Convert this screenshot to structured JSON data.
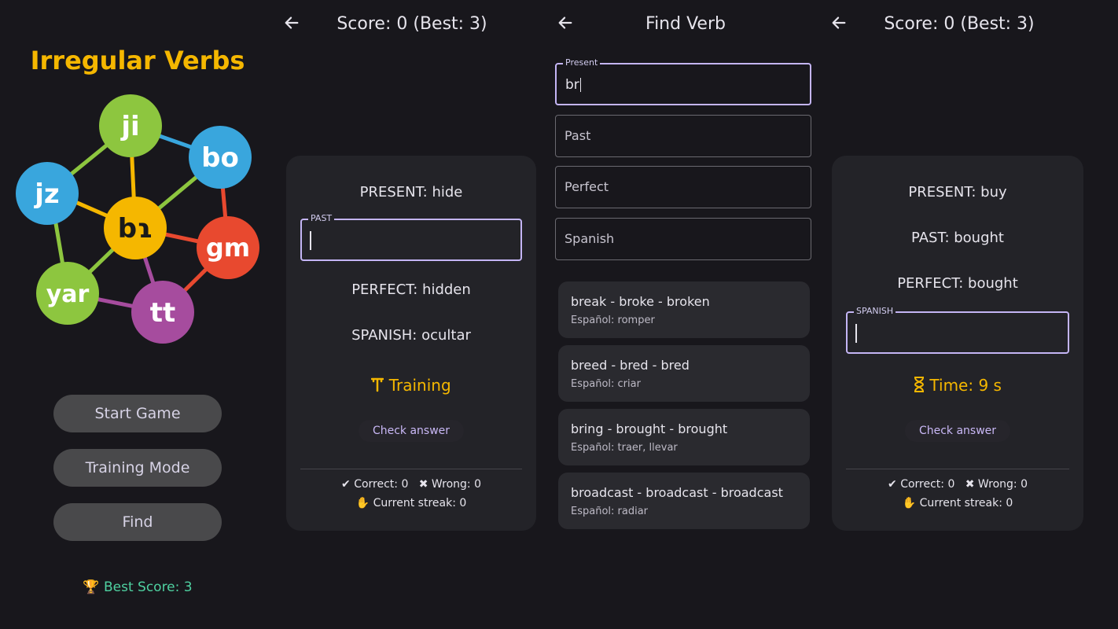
{
  "menu": {
    "title": "Irregular Verbs",
    "graph_nodes": [
      {
        "label": "ji",
        "color": "#8dc63f"
      },
      {
        "label": "bo",
        "color": "#39a6dd"
      },
      {
        "label": "jz",
        "color": "#39a6dd"
      },
      {
        "label": "bɿ",
        "color": "#f5b700"
      },
      {
        "label": "gm",
        "color": "#e8492f"
      },
      {
        "label": "yar",
        "color": "#8dc63f"
      },
      {
        "label": "tt",
        "color": "#a64c9e"
      }
    ],
    "buttons": {
      "start": "Start Game",
      "training": "Training Mode",
      "find": "Find"
    },
    "best_score": "🏆 Best Score: 3"
  },
  "training": {
    "header_title": "Score: 0  (Best: 3)",
    "present": "PRESENT: hide",
    "past_label": "PAST",
    "past_value": "",
    "perfect": "PERFECT: hidden",
    "spanish": "SPANISH: ocultar",
    "mode_label": "Training",
    "mode_icon": "dumbbell-icon",
    "check_label": "Check answer",
    "correct": "✔ Correct: 0",
    "wrong": "✖ Wrong: 0",
    "streak": "Current streak: 0"
  },
  "find": {
    "header_title": "Find Verb",
    "present_label": "Present",
    "present_value": "br",
    "past_placeholder": "Past",
    "perfect_placeholder": "Perfect",
    "spanish_placeholder": "Spanish",
    "results": [
      {
        "forms": "break - broke - broken",
        "es": "Español: romper"
      },
      {
        "forms": "breed - bred - bred",
        "es": "Español: criar"
      },
      {
        "forms": "bring - brought - brought",
        "es": "Español: traer, llevar"
      },
      {
        "forms": "broadcast - broadcast - broadcast",
        "es": "Español: radiar"
      }
    ]
  },
  "game": {
    "header_title": "Score: 0  (Best: 3)",
    "present": "PRESENT: buy",
    "past": "PAST: bought",
    "perfect": "PERFECT: bought",
    "spanish_label": "SPANISH",
    "spanish_value": "",
    "timer": "Time: 9 s",
    "timer_icon": "hourglass-icon",
    "check_label": "Check answer",
    "correct": "✔ Correct: 0",
    "wrong": "✖ Wrong: 0",
    "streak": "Current streak: 0"
  },
  "colors": {
    "accent": "#f5b700",
    "focus": "#c4b5f5",
    "best": "#4fd1a1",
    "bg": "#18171c",
    "card": "#232328"
  }
}
